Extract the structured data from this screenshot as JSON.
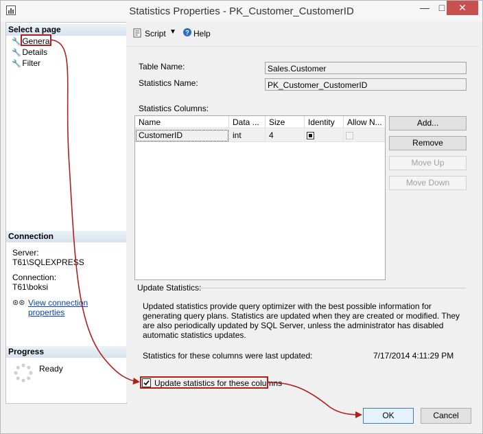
{
  "window": {
    "title": "Statistics Properties - PK_Customer_CustomerID"
  },
  "left_panel": {
    "select_heading": "Select a page",
    "pages": [
      {
        "label": "General"
      },
      {
        "label": "Details"
      },
      {
        "label": "Filter"
      }
    ],
    "connection_heading": "Connection",
    "server_label": "Server:",
    "server_value": "T61\\SQLEXPRESS",
    "connection_label": "Connection:",
    "connection_value": "T61\\boksi",
    "view_link": "View connection properties",
    "progress_heading": "Progress",
    "progress_status": "Ready"
  },
  "toolbar": {
    "script_label": "Script",
    "help_label": "Help"
  },
  "general": {
    "table_name_label": "Table Name:",
    "table_name_value": "Sales.Customer",
    "stats_name_label": "Statistics Name:",
    "stats_name_value": "PK_Customer_CustomerID",
    "columns_label": "Statistics Columns:",
    "grid": {
      "headers": [
        "Name",
        "Data ...",
        "Size",
        "Identity",
        "Allow N..."
      ],
      "rows": [
        {
          "name": "CustomerID",
          "type": "int",
          "size": "4",
          "identity": true,
          "allow_nulls": false
        }
      ]
    },
    "buttons": {
      "add": "Add...",
      "remove": "Remove",
      "move_up": "Move Up",
      "move_down": "Move Down"
    },
    "update_heading": "Update Statistics:",
    "update_description": "Updated statistics provide query optimizer with the best possible information for generating query plans. Statistics are updated when they are created or modified. They are also periodically updated by SQL Server, unless the administrator has disabled automatic statistics updates.",
    "last_updated_label": "Statistics for these columns were last updated:",
    "last_updated_value": "7/17/2014 4:11:29 PM",
    "update_checkbox_label": "Update statistics for these columns",
    "update_checked": true
  },
  "footer": {
    "ok": "OK",
    "cancel": "Cancel"
  },
  "colors": {
    "annotation": "#b11c1c",
    "link": "#0645ad"
  }
}
